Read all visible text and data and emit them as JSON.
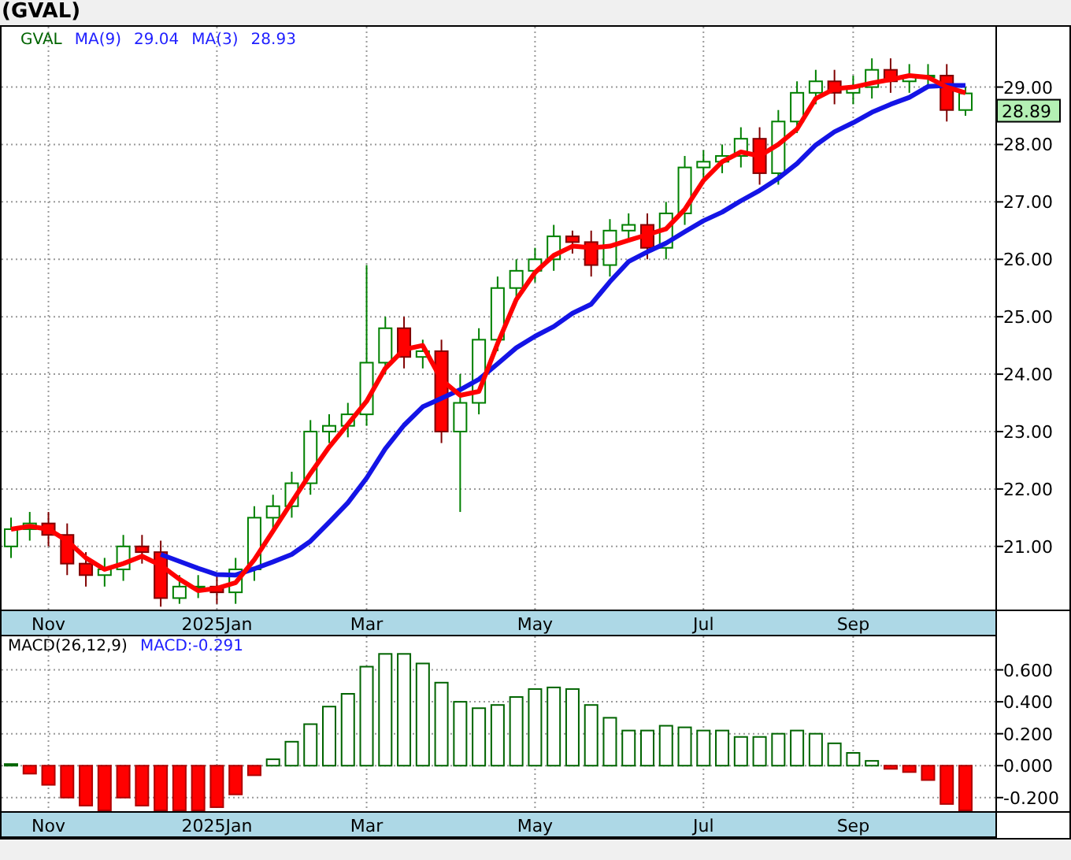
{
  "title": "(GVAL)",
  "price_panel": {
    "ticker": "GVAL",
    "readings": [
      "29.04",
      "28.93"
    ],
    "last_price": "28.89",
    "chart_data": {
      "type": "candlestick",
      "grid": true,
      "ylim": [
        19.9,
        30.05
      ],
      "categories": [
        null,
        null,
        "Nov",
        null,
        null,
        null,
        null,
        null,
        null,
        null,
        null,
        "2025Jan",
        null,
        null,
        null,
        null,
        null,
        null,
        null,
        "Mar",
        null,
        null,
        null,
        null,
        null,
        null,
        null,
        null,
        "May",
        null,
        null,
        null,
        null,
        null,
        null,
        null,
        null,
        "Jul",
        null,
        null,
        null,
        null,
        null,
        null,
        null,
        "Sep",
        null,
        null,
        null,
        null,
        null,
        null
      ],
      "ohlc": [
        [
          21.0,
          21.5,
          20.8,
          21.3
        ],
        [
          21.3,
          21.6,
          21.1,
          21.4
        ],
        [
          21.4,
          21.6,
          21.0,
          21.2
        ],
        [
          21.2,
          21.4,
          20.5,
          20.7
        ],
        [
          20.7,
          20.9,
          20.3,
          20.5
        ],
        [
          20.5,
          20.8,
          20.3,
          20.6
        ],
        [
          20.6,
          21.2,
          20.4,
          21.0
        ],
        [
          21.0,
          21.2,
          20.7,
          20.9
        ],
        [
          20.9,
          21.1,
          19.95,
          20.1
        ],
        [
          20.1,
          20.5,
          20.0,
          20.3
        ],
        [
          20.3,
          20.5,
          20.1,
          20.3
        ],
        [
          20.3,
          20.5,
          20.0,
          20.2
        ],
        [
          20.2,
          20.8,
          20.0,
          20.6
        ],
        [
          20.6,
          21.7,
          20.4,
          21.5
        ],
        [
          21.5,
          21.9,
          21.3,
          21.7
        ],
        [
          21.7,
          22.3,
          21.5,
          22.1
        ],
        [
          22.1,
          23.2,
          21.9,
          23.0
        ],
        [
          23.0,
          23.3,
          22.8,
          23.1
        ],
        [
          23.1,
          23.5,
          22.9,
          23.3
        ],
        [
          23.3,
          25.9,
          23.1,
          24.2
        ],
        [
          24.2,
          25.0,
          24.0,
          24.8
        ],
        [
          24.8,
          25.0,
          24.1,
          24.3
        ],
        [
          24.3,
          24.6,
          24.1,
          24.4
        ],
        [
          24.4,
          24.6,
          22.8,
          23.0
        ],
        [
          23.0,
          24.0,
          21.6,
          23.5
        ],
        [
          23.5,
          24.8,
          23.3,
          24.6
        ],
        [
          24.6,
          25.7,
          24.4,
          25.5
        ],
        [
          25.5,
          26.0,
          25.3,
          25.8
        ],
        [
          25.8,
          26.2,
          25.6,
          26.0
        ],
        [
          26.0,
          26.6,
          25.8,
          26.4
        ],
        [
          26.4,
          26.5,
          26.1,
          26.3
        ],
        [
          26.3,
          26.5,
          25.7,
          25.9
        ],
        [
          25.9,
          26.7,
          25.7,
          26.5
        ],
        [
          26.5,
          26.8,
          26.3,
          26.6
        ],
        [
          26.6,
          26.8,
          26.0,
          26.2
        ],
        [
          26.2,
          27.0,
          26.0,
          26.8
        ],
        [
          26.8,
          27.8,
          26.6,
          27.6
        ],
        [
          27.6,
          27.9,
          27.4,
          27.7
        ],
        [
          27.7,
          28.0,
          27.5,
          27.8
        ],
        [
          27.8,
          28.3,
          27.6,
          28.1
        ],
        [
          28.1,
          28.3,
          27.3,
          27.5
        ],
        [
          27.5,
          28.6,
          27.3,
          28.4
        ],
        [
          28.4,
          29.1,
          28.2,
          28.9
        ],
        [
          28.9,
          29.3,
          28.7,
          29.1
        ],
        [
          29.1,
          29.3,
          28.7,
          28.9
        ],
        [
          28.9,
          29.2,
          28.7,
          29.0
        ],
        [
          29.0,
          29.5,
          28.8,
          29.3
        ],
        [
          29.3,
          29.5,
          28.9,
          29.1
        ],
        [
          29.1,
          29.4,
          28.9,
          29.2
        ],
        [
          29.2,
          29.4,
          29.0,
          29.2
        ],
        [
          29.2,
          29.4,
          28.4,
          28.6
        ],
        [
          28.6,
          29.0,
          28.5,
          28.89
        ]
      ],
      "series": [
        {
          "name": "MA(9)",
          "type": "line",
          "color": "#1414e6",
          "values": [
            null,
            null,
            null,
            null,
            null,
            null,
            null,
            null,
            20.86,
            20.74,
            20.62,
            20.51,
            20.5,
            20.61,
            20.73,
            20.86,
            21.09,
            21.42,
            21.76,
            22.19,
            22.7,
            23.11,
            23.43,
            23.58,
            23.73,
            23.91,
            24.18,
            24.46,
            24.66,
            24.83,
            25.06,
            25.22,
            25.61,
            25.96,
            26.13,
            26.28,
            26.48,
            26.67,
            26.82,
            27.02,
            27.2,
            27.41,
            27.67,
            27.99,
            28.22,
            28.38,
            28.56,
            28.7,
            28.82,
            29.01,
            29.03,
            29.03
          ]
        },
        {
          "name": "MA(3)",
          "type": "line",
          "color": "#ff0000",
          "values": [
            21.3,
            21.35,
            21.3,
            21.1,
            20.8,
            20.6,
            20.7,
            20.83,
            20.67,
            20.43,
            20.23,
            20.27,
            20.37,
            20.77,
            21.27,
            21.77,
            22.27,
            22.73,
            23.13,
            23.53,
            24.1,
            24.43,
            24.5,
            23.9,
            23.63,
            23.7,
            24.53,
            25.3,
            25.77,
            26.07,
            26.23,
            26.2,
            26.23,
            26.33,
            26.43,
            26.53,
            26.87,
            27.37,
            27.7,
            27.87,
            27.8,
            28,
            28.27,
            28.8,
            28.97,
            29,
            29.07,
            29.13,
            29.2,
            29.17,
            29,
            28.9
          ]
        }
      ],
      "yticks": [
        {
          "value": 21,
          "label": "21.00"
        },
        {
          "value": 22,
          "label": "22.00"
        },
        {
          "value": 23,
          "label": "23.00"
        },
        {
          "value": 24,
          "label": "24.00"
        },
        {
          "value": 25,
          "label": "25.00"
        },
        {
          "value": 26,
          "label": "26.00"
        },
        {
          "value": 27,
          "label": "27.00"
        },
        {
          "value": 28,
          "label": "28.00"
        },
        {
          "value": 29,
          "label": "29.00"
        }
      ]
    }
  },
  "macd_panel": {
    "reading": "MACD:-0.291",
    "chart_data": {
      "type": "bar",
      "grid": true,
      "ylim": [
        -0.285,
        0.81
      ],
      "categories": [
        null,
        null,
        "Nov",
        null,
        null,
        null,
        null,
        null,
        null,
        null,
        null,
        "2025Jan",
        null,
        null,
        null,
        null,
        null,
        null,
        null,
        "Mar",
        null,
        null,
        null,
        null,
        null,
        null,
        null,
        null,
        "May",
        null,
        null,
        null,
        null,
        null,
        null,
        null,
        null,
        "Jul",
        null,
        null,
        null,
        null,
        null,
        null,
        null,
        "Sep",
        null,
        null,
        null,
        null,
        null,
        null
      ],
      "series": [
        {
          "name": "MACD(26,12,9)",
          "values": [
            0.01,
            -0.05,
            -0.12,
            -0.2,
            -0.25,
            -0.28,
            -0.2,
            -0.25,
            -0.28,
            -0.28,
            -0.28,
            -0.26,
            -0.18,
            -0.06,
            0.04,
            0.15,
            0.26,
            0.37,
            0.45,
            0.62,
            0.7,
            0.7,
            0.64,
            0.52,
            0.4,
            0.36,
            0.38,
            0.43,
            0.48,
            0.49,
            0.48,
            0.38,
            0.3,
            0.22,
            0.22,
            0.25,
            0.24,
            0.22,
            0.22,
            0.18,
            0.18,
            0.2,
            0.22,
            0.2,
            0.14,
            0.08,
            0.03,
            -0.02,
            -0.04,
            -0.09,
            -0.24,
            -0.28
          ]
        }
      ],
      "yticks": [
        {
          "value": -0.2,
          "label": "-0.200"
        },
        {
          "value": 0,
          "label": "0.000"
        },
        {
          "value": 0.2,
          "label": "0.200"
        },
        {
          "value": 0.4,
          "label": "0.400"
        },
        {
          "value": 0.6,
          "label": "0.600"
        }
      ]
    }
  }
}
